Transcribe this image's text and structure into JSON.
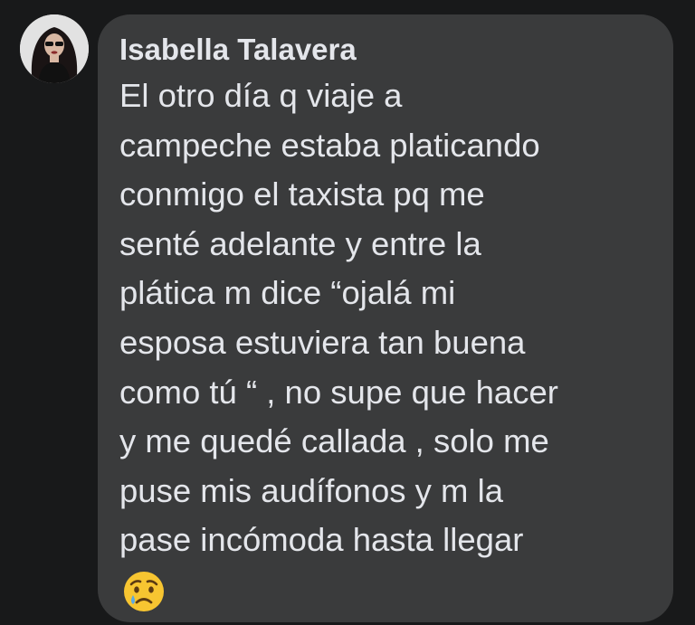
{
  "comment": {
    "author": "Isabella Talavera",
    "lines": [
      "El otro día q viaje a",
      "campeche estaba platicando",
      "conmigo el taxista pq me",
      "senté adelante y entre la",
      "plática m dice “ojalá mi",
      "esposa estuviera tan buena",
      "como tú “ , no supe que hacer",
      "y me quedé callada , solo me",
      "puse mis audífonos y m la",
      "pase incómoda hasta llegar"
    ],
    "emoji": "sad-but-relieved-face-icon"
  },
  "colors": {
    "background": "#18191a",
    "bubble": "#3a3b3c",
    "text": "#e4e6eb",
    "emoji_face": "#f7c531",
    "emoji_tear": "#5aa9e6"
  }
}
